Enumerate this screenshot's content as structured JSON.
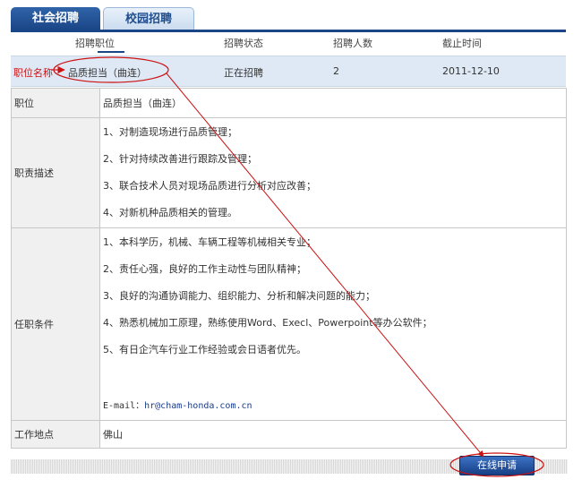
{
  "tabs": [
    {
      "label": "社会招聘",
      "active": true
    },
    {
      "label": "校园招聘",
      "active": false
    }
  ],
  "columns": [
    "招聘职位",
    "招聘状态",
    "招聘人数",
    "截止时间"
  ],
  "job": {
    "annotation_label": "职位名称",
    "title": "品质担当（曲连）",
    "status": "正在招聘",
    "count": "2",
    "deadline": "2011-12-10"
  },
  "detail": {
    "position_label": "职位",
    "position_value": "品质担当（曲连）",
    "duties_label": "职责描述",
    "duties": [
      "1、对制造现场进行品质管理；",
      "2、针对持续改善进行跟踪及管理；",
      "3、联合技术人员对现场品质进行分析对应改善；",
      "4、对新机种品质相关的管理。"
    ],
    "requirements_label": "任职条件",
    "requirements": [
      "1、本科学历，机械、车辆工程等机械相关专业；",
      "2、责任心强，良好的工作主动性与团队精神；",
      "3、良好的沟通协调能力、组织能力、分析和解决问题的能力；",
      "4、熟悉机械加工原理，熟练使用Word、Execl、Powerpoint等办公软件；",
      "5、有日企汽车行业工作经验或会日语者优先。"
    ],
    "email_label": "E-mail：",
    "email": "hr@cham-honda.com.cn",
    "location_label": "工作地点",
    "location_value": "佛山"
  },
  "apply_button": "在线申请",
  "colors": {
    "accent": "#1a4586",
    "annotation": "#cc1111",
    "row_highlight": "#dfe9f6"
  }
}
